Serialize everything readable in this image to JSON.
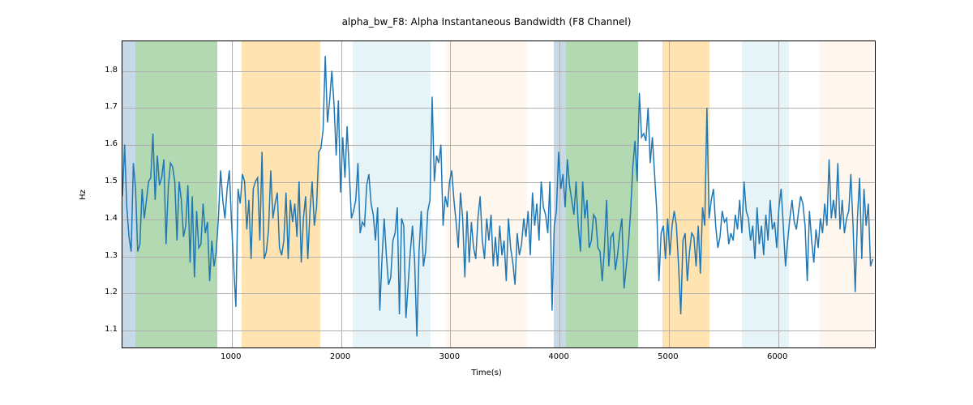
{
  "chart_data": {
    "type": "line",
    "title": "alpha_bw_F8: Alpha Instantaneous Bandwidth (F8 Channel)",
    "xlabel": "Time(s)",
    "ylabel": "Hz",
    "xlim": [
      0,
      6900
    ],
    "ylim": [
      1.05,
      1.88
    ],
    "xticks": [
      1000,
      2000,
      3000,
      4000,
      5000,
      6000
    ],
    "yticks": [
      1.1,
      1.2,
      1.3,
      1.4,
      1.5,
      1.6,
      1.7,
      1.8
    ],
    "bands": [
      {
        "x0": 0,
        "x1": 120,
        "color": "steelblue"
      },
      {
        "x0": 120,
        "x1": 870,
        "color": "green"
      },
      {
        "x0": 1090,
        "x1": 1810,
        "color": "orange"
      },
      {
        "x0": 2110,
        "x1": 2820,
        "color": "lightblue"
      },
      {
        "x0": 2960,
        "x1": 3700,
        "color": "bisque"
      },
      {
        "x0": 3950,
        "x1": 4060,
        "color": "steelblue"
      },
      {
        "x0": 4060,
        "x1": 4720,
        "color": "green"
      },
      {
        "x0": 4940,
        "x1": 5370,
        "color": "orange"
      },
      {
        "x0": 5670,
        "x1": 6100,
        "color": "lightblue"
      },
      {
        "x0": 6380,
        "x1": 6880,
        "color": "bisque"
      }
    ],
    "series": [
      {
        "name": "alpha_bw_F8",
        "color": "#1f77b4",
        "x_step": 20,
        "x_start": 0,
        "y": [
          1.46,
          1.6,
          1.43,
          1.35,
          1.31,
          1.55,
          1.48,
          1.31,
          1.33,
          1.48,
          1.4,
          1.45,
          1.5,
          1.51,
          1.63,
          1.45,
          1.57,
          1.49,
          1.51,
          1.56,
          1.33,
          1.48,
          1.55,
          1.54,
          1.5,
          1.34,
          1.5,
          1.45,
          1.35,
          1.38,
          1.49,
          1.28,
          1.46,
          1.24,
          1.42,
          1.32,
          1.33,
          1.44,
          1.36,
          1.39,
          1.23,
          1.34,
          1.27,
          1.31,
          1.4,
          1.53,
          1.45,
          1.4,
          1.48,
          1.53,
          1.39,
          1.27,
          1.16,
          1.48,
          1.44,
          1.52,
          1.5,
          1.37,
          1.45,
          1.29,
          1.48,
          1.5,
          1.51,
          1.34,
          1.58,
          1.29,
          1.31,
          1.37,
          1.53,
          1.4,
          1.44,
          1.47,
          1.32,
          1.3,
          1.34,
          1.47,
          1.29,
          1.45,
          1.39,
          1.44,
          1.35,
          1.5,
          1.28,
          1.4,
          1.46,
          1.29,
          1.42,
          1.5,
          1.38,
          1.43,
          1.58,
          1.59,
          1.64,
          1.84,
          1.66,
          1.72,
          1.8,
          1.71,
          1.57,
          1.72,
          1.47,
          1.62,
          1.51,
          1.65,
          1.53,
          1.4,
          1.42,
          1.45,
          1.55,
          1.36,
          1.39,
          1.38,
          1.49,
          1.52,
          1.44,
          1.41,
          1.34,
          1.43,
          1.15,
          1.29,
          1.4,
          1.3,
          1.22,
          1.24,
          1.34,
          1.36,
          1.43,
          1.14,
          1.4,
          1.38,
          1.13,
          1.22,
          1.31,
          1.38,
          1.28,
          1.08,
          1.31,
          1.42,
          1.27,
          1.31,
          1.42,
          1.45,
          1.73,
          1.5,
          1.57,
          1.55,
          1.6,
          1.38,
          1.46,
          1.43,
          1.5,
          1.53,
          1.45,
          1.39,
          1.32,
          1.47,
          1.4,
          1.24,
          1.42,
          1.28,
          1.39,
          1.32,
          1.29,
          1.4,
          1.46,
          1.34,
          1.29,
          1.4,
          1.34,
          1.41,
          1.27,
          1.35,
          1.27,
          1.38,
          1.3,
          1.34,
          1.23,
          1.4,
          1.32,
          1.28,
          1.22,
          1.36,
          1.3,
          1.33,
          1.4,
          1.35,
          1.42,
          1.3,
          1.47,
          1.38,
          1.44,
          1.34,
          1.5,
          1.43,
          1.41,
          1.36,
          1.5,
          1.15,
          1.38,
          1.42,
          1.58,
          1.48,
          1.52,
          1.43,
          1.56,
          1.49,
          1.45,
          1.41,
          1.5,
          1.38,
          1.31,
          1.5,
          1.4,
          1.45,
          1.32,
          1.34,
          1.41,
          1.4,
          1.32,
          1.31,
          1.23,
          1.32,
          1.45,
          1.27,
          1.35,
          1.36,
          1.26,
          1.3,
          1.36,
          1.4,
          1.21,
          1.27,
          1.33,
          1.42,
          1.54,
          1.61,
          1.5,
          1.74,
          1.62,
          1.63,
          1.61,
          1.7,
          1.55,
          1.62,
          1.52,
          1.42,
          1.23,
          1.36,
          1.38,
          1.29,
          1.4,
          1.3,
          1.38,
          1.42,
          1.38,
          1.27,
          1.14,
          1.34,
          1.36,
          1.23,
          1.31,
          1.36,
          1.35,
          1.27,
          1.38,
          1.25,
          1.43,
          1.38,
          1.7,
          1.4,
          1.45,
          1.48,
          1.38,
          1.32,
          1.35,
          1.42,
          1.39,
          1.4,
          1.33,
          1.36,
          1.34,
          1.41,
          1.37,
          1.45,
          1.36,
          1.5,
          1.42,
          1.4,
          1.34,
          1.38,
          1.29,
          1.43,
          1.33,
          1.38,
          1.3,
          1.41,
          1.34,
          1.45,
          1.37,
          1.39,
          1.32,
          1.43,
          1.48,
          1.38,
          1.27,
          1.34,
          1.4,
          1.45,
          1.39,
          1.37,
          1.42,
          1.46,
          1.44,
          1.38,
          1.23,
          1.42,
          1.34,
          1.28,
          1.37,
          1.32,
          1.4,
          1.36,
          1.44,
          1.38,
          1.56,
          1.4,
          1.45,
          1.4,
          1.55,
          1.37,
          1.45,
          1.36,
          1.4,
          1.42,
          1.52,
          1.38,
          1.2,
          1.4,
          1.51,
          1.29,
          1.48,
          1.38,
          1.44,
          1.27,
          1.29
        ]
      }
    ]
  }
}
